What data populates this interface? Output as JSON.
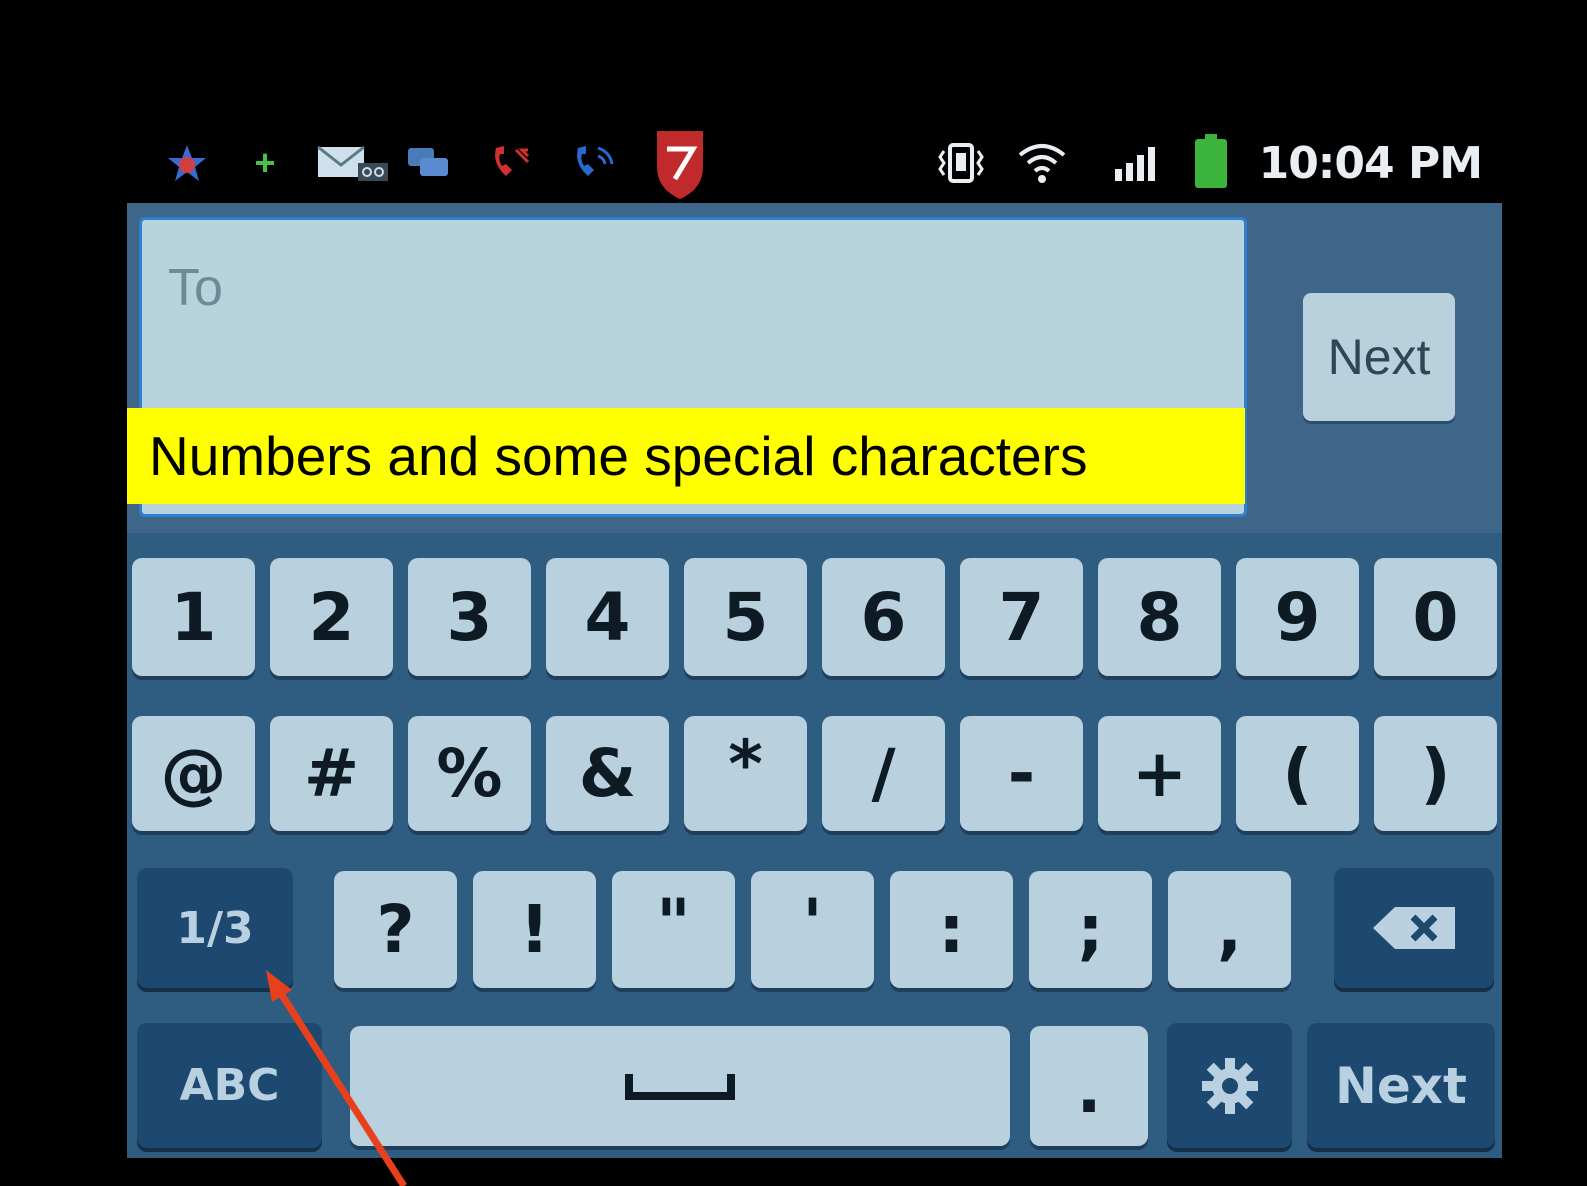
{
  "status_bar": {
    "time": "10:04 PM",
    "icons": [
      "star-notification-icon",
      "plus-icon",
      "voicemail-icon",
      "chat-icon",
      "missed-call-icon",
      "phone-call-icon",
      "shield-app-icon",
      "vibrate-icon",
      "wifi-icon",
      "signal-icon",
      "battery-icon"
    ]
  },
  "compose": {
    "to_placeholder": "To",
    "next_label": "Next"
  },
  "caption": "Numbers and some special characters",
  "keyboard": {
    "row1": [
      "1",
      "2",
      "3",
      "4",
      "5",
      "6",
      "7",
      "8",
      "9",
      "0"
    ],
    "row2": [
      "@",
      "#",
      "%",
      "&",
      "*",
      "/",
      "-",
      "+",
      "(",
      ")"
    ],
    "row3": [
      "?",
      "!",
      "\"",
      "'",
      ":",
      ";",
      ","
    ],
    "page_label": "1/3",
    "abc_label": "ABC",
    "period_label": ".",
    "next_label": "Next"
  },
  "colors": {
    "annotation_arrow": "#e8401c",
    "caption_bg": "#ffff00",
    "keyboard_bg": "#2f5d82"
  }
}
